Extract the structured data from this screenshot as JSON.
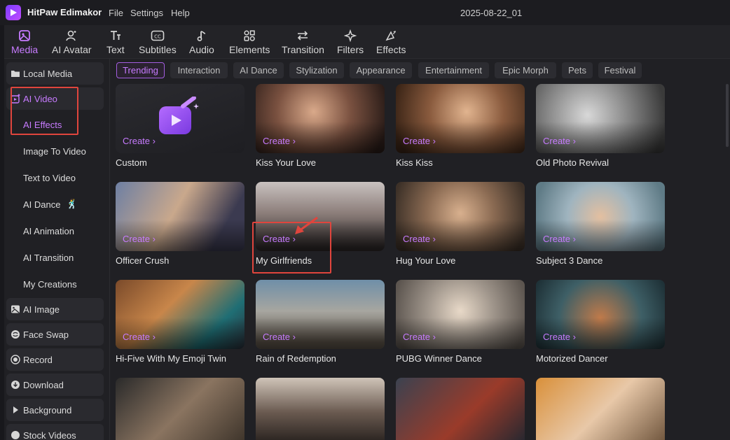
{
  "app": {
    "name": "HitPaw Edimakor",
    "menus": [
      "File",
      "Settings",
      "Help"
    ],
    "project_title": "2025-08-22_01"
  },
  "toolbar": {
    "tools": [
      {
        "label": "Media",
        "icon": "media-icon",
        "active": true
      },
      {
        "label": "AI Avatar",
        "icon": "avatar-icon"
      },
      {
        "label": "Text",
        "icon": "text-icon"
      },
      {
        "label": "Subtitles",
        "icon": "subtitles-icon"
      },
      {
        "label": "Audio",
        "icon": "audio-icon"
      },
      {
        "label": "Elements",
        "icon": "elements-icon"
      },
      {
        "label": "Transition",
        "icon": "transition-icon"
      },
      {
        "label": "Filters",
        "icon": "filters-icon"
      },
      {
        "label": "Effects",
        "icon": "effects-icon"
      }
    ]
  },
  "sidebar": {
    "items": [
      {
        "label": "Local Media",
        "icon": "folder-icon"
      },
      {
        "label": "AI Video",
        "icon": "ai-video-icon",
        "active": true
      },
      {
        "label": "AI Effects",
        "active": true
      },
      {
        "label": "Image To Video"
      },
      {
        "label": "Text to Video"
      },
      {
        "label": "AI Dance",
        "emoji": "🕺"
      },
      {
        "label": "AI Animation"
      },
      {
        "label": "AI Transition"
      },
      {
        "label": "My Creations"
      },
      {
        "label": "AI Image",
        "icon": "image-icon"
      },
      {
        "label": "Face Swap",
        "icon": "face-swap-icon"
      },
      {
        "label": "Record",
        "icon": "record-icon"
      },
      {
        "label": "Download",
        "icon": "download-icon"
      },
      {
        "label": "Background",
        "icon": "play-triangle-icon"
      },
      {
        "label": "Stock Videos",
        "icon": "stock-icon"
      }
    ]
  },
  "tags": [
    "Trending",
    "Interaction",
    "AI Dance",
    "Stylization",
    "Appearance",
    "Entertainment",
    "Epic Morph",
    "Pets",
    "Festival"
  ],
  "create_label": "Create",
  "cards": [
    {
      "title": "Custom"
    },
    {
      "title": "Kiss Your Love"
    },
    {
      "title": "Kiss Kiss"
    },
    {
      "title": "Old Photo Revival"
    },
    {
      "title": "Officer Crush"
    },
    {
      "title": "My Girlfriends"
    },
    {
      "title": "Hug Your Love"
    },
    {
      "title": "Subject 3 Dance"
    },
    {
      "title": "Hi-Five With My Emoji Twin"
    },
    {
      "title": "Rain of Redemption"
    },
    {
      "title": "PUBG Winner Dance"
    },
    {
      "title": "Motorized Dancer"
    },
    {
      "title": ""
    },
    {
      "title": ""
    },
    {
      "title": ""
    },
    {
      "title": ""
    }
  ],
  "colors": {
    "accent": "#c77bff",
    "highlight": "#e0453d",
    "background": "#18181c"
  }
}
